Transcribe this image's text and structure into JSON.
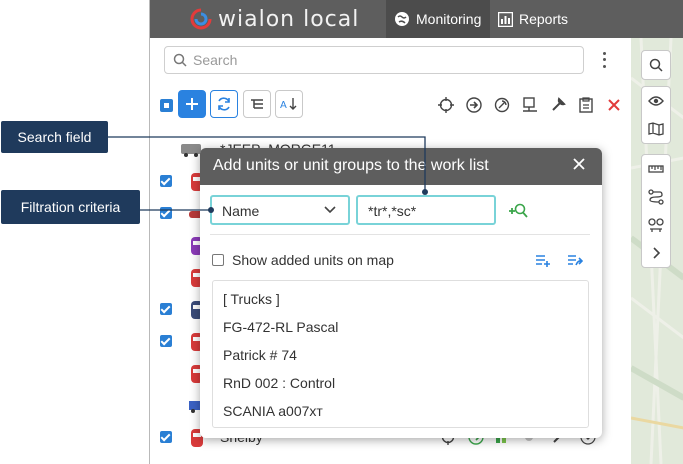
{
  "header": {
    "logo_text": "wialon local",
    "tabs": [
      {
        "label": "Monitoring",
        "icon": "globe-icon",
        "active": true
      },
      {
        "label": "Reports",
        "icon": "chart-icon",
        "active": false
      }
    ]
  },
  "search": {
    "placeholder": "Search"
  },
  "units": [
    {
      "name": "*JEEP_MORGE11",
      "checked": false
    },
    {
      "name": "",
      "checked": true
    },
    {
      "name": "",
      "checked": true
    },
    {
      "name": "",
      "checked": false
    },
    {
      "name": "",
      "checked": false
    },
    {
      "name": "",
      "checked": true
    },
    {
      "name": "",
      "checked": true
    },
    {
      "name": "",
      "checked": false
    },
    {
      "name": "",
      "checked": false
    },
    {
      "name": "Shelby",
      "checked": true
    }
  ],
  "dialog": {
    "title": "Add units or unit groups to the work list",
    "filter_value": "Name",
    "search_value": "*tr*,*sc*",
    "show_on_map_label": "Show added units on map",
    "results": [
      "[ Trucks ]",
      "FG-472-RL Pascal",
      "Patrick # 74",
      "RnD 002 : Control",
      "SCANIA a007xт"
    ]
  },
  "callouts": {
    "search_field": "Search field",
    "filtration": "Filtration criteria"
  },
  "colors": {
    "header_bg": "#5e5e5e",
    "accent_blue": "#2a82e0",
    "teal_border": "#79d3d8",
    "callout_bg": "#1f3a5c",
    "danger": "#e23b3b",
    "green": "#3aa54a"
  }
}
